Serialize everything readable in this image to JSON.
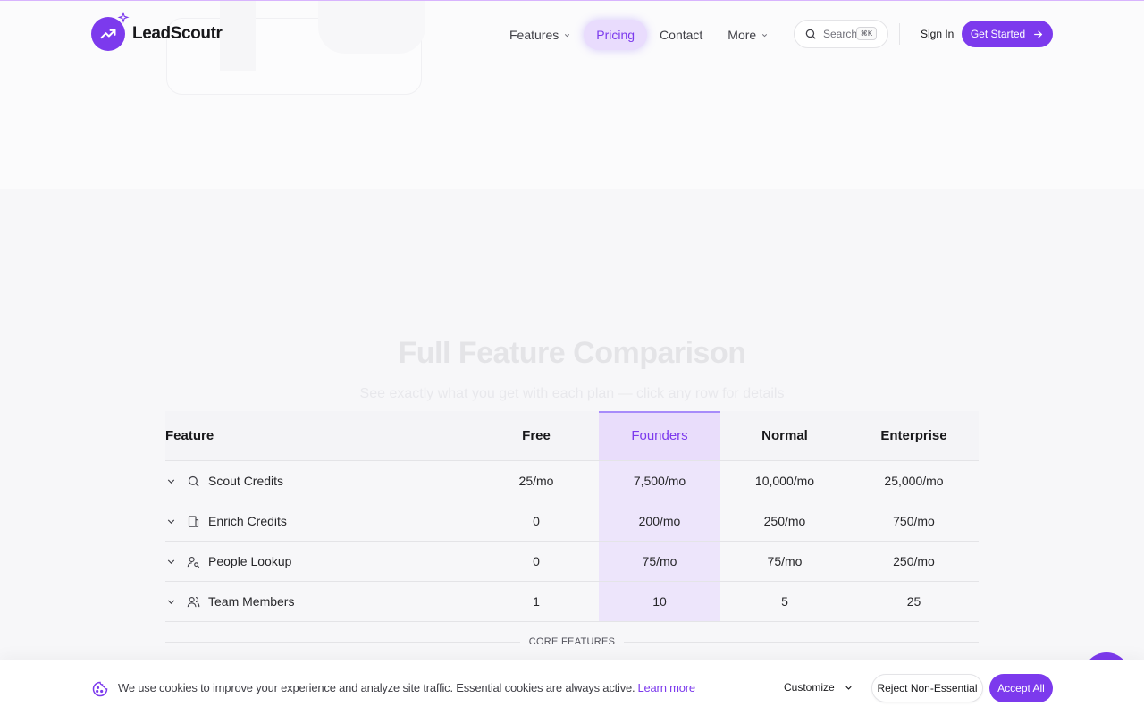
{
  "brand": {
    "name": "LeadScoutr",
    "accent": "#7c3aed"
  },
  "nav": {
    "items": [
      {
        "label": "Features",
        "has_dropdown": true,
        "active": false
      },
      {
        "label": "Pricing",
        "has_dropdown": false,
        "active": true
      },
      {
        "label": "Contact",
        "has_dropdown": false,
        "active": false
      },
      {
        "label": "More",
        "has_dropdown": true,
        "active": false
      }
    ],
    "search_label": "Search",
    "search_shortcut": "⌘K",
    "sign_in": "Sign In",
    "cta": "Get Started"
  },
  "comparison": {
    "title": "Full Feature Comparison",
    "subtitle": "See exactly what you get with each plan — click any row for details",
    "headers": [
      "Feature",
      "Free",
      "Founders",
      "Normal",
      "Enterprise"
    ],
    "highlighted_plan": "Founders",
    "rows": [
      {
        "icon": "search-icon",
        "label": "Scout Credits",
        "values": [
          "25/mo",
          "7,500/mo",
          "10,000/mo",
          "25,000/mo"
        ]
      },
      {
        "icon": "building-icon",
        "label": "Enrich Credits",
        "values": [
          "0",
          "200/mo",
          "250/mo",
          "750/mo"
        ]
      },
      {
        "icon": "user-search-icon",
        "label": "People Lookup",
        "values": [
          "0",
          "75/mo",
          "75/mo",
          "250/mo"
        ]
      },
      {
        "icon": "users-icon",
        "label": "Team Members",
        "values": [
          "1",
          "10",
          "5",
          "25"
        ]
      }
    ],
    "group_label": "CORE FEATURES"
  },
  "cookie": {
    "text": "We use cookies to improve your experience and analyze site traffic. Essential cookies are always active.",
    "link": "Learn more",
    "customize": "Customize",
    "reject": "Reject Non-Essential",
    "accept": "Accept All"
  }
}
